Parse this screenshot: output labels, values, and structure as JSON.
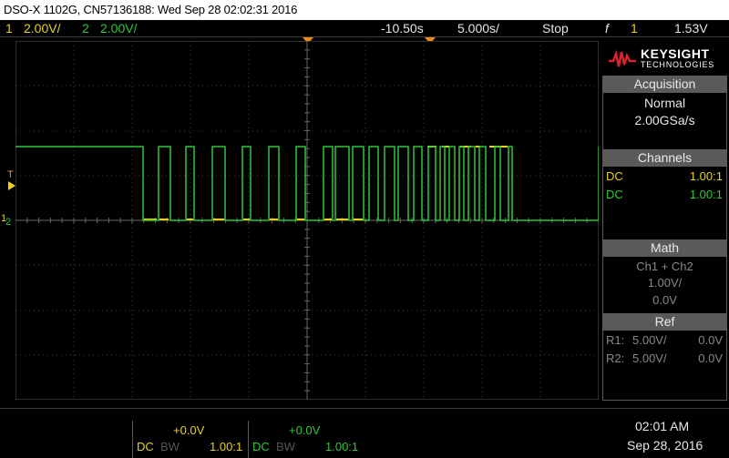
{
  "window": {
    "title": "DSO-X 1102G, CN57136188: Wed Sep 28 02:02:31 2016"
  },
  "topbar": {
    "ch1_num": "1",
    "ch1_scale": "2.00V/",
    "ch2_num": "2",
    "ch2_scale": "2.00V/",
    "delay": "-10.50s",
    "timebase": "5.000s/",
    "run_state": "Stop",
    "trigger_icon": "f",
    "trigger_source": "1",
    "trigger_level": "1.53V"
  },
  "logo": {
    "brand": "KEYSIGHT",
    "sub": "TECHNOLOGIES"
  },
  "acquisition": {
    "header": "Acquisition",
    "mode": "Normal",
    "rate": "2.00GSa/s"
  },
  "channels": {
    "header": "Channels",
    "rows": [
      {
        "coupling": "DC",
        "probe": "1.00:1"
      },
      {
        "coupling": "DC",
        "probe": "1.00:1"
      }
    ]
  },
  "math": {
    "header": "Math",
    "expr": "Ch1 + Ch2",
    "scale": "1.00V/",
    "offset": "0.0V"
  },
  "ref": {
    "header": "Ref",
    "rows": [
      {
        "name": "R1:",
        "scale": "5.00V/",
        "offset": "0.0V"
      },
      {
        "name": "R2:",
        "scale": "5.00V/",
        "offset": "0.0V"
      }
    ]
  },
  "bottom": {
    "ch1": {
      "offset": "+0.0V",
      "coupling": "DC",
      "bw": "BW",
      "probe": "1.00:1"
    },
    "ch2": {
      "offset": "+0.0V",
      "coupling": "DC",
      "bw": "BW",
      "probe": "1.00:1"
    },
    "time": "02:01 AM",
    "date": "Sep 28, 2016"
  },
  "markers": {
    "trigger_level_label": "T",
    "ch1_marker": "1",
    "ch2_marker": "2"
  },
  "colors": {
    "ch1": "#e8d21c",
    "ch2": "#2ec83a",
    "grid": "#4a4a4a",
    "trigger": "#f08a1c"
  }
}
